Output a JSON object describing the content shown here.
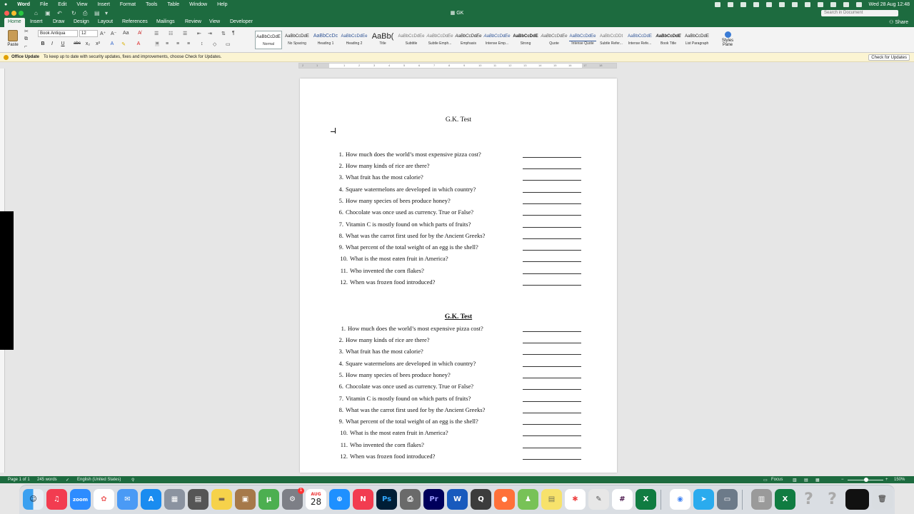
{
  "menubar": {
    "apple": "",
    "items": [
      "Word",
      "File",
      "Edit",
      "View",
      "Insert",
      "Format",
      "Tools",
      "Table",
      "Window",
      "Help"
    ],
    "clock": "Wed 28 Aug  12:48"
  },
  "window": {
    "title": "GK",
    "search_placeholder": "Search in Document",
    "share_label": "Share"
  },
  "tabs": [
    "Home",
    "Insert",
    "Draw",
    "Design",
    "Layout",
    "References",
    "Mailings",
    "Review",
    "View",
    "Developer"
  ],
  "ribbon": {
    "paste_label": "Paste",
    "font_name": "Book Antiqua",
    "font_size": "12",
    "styles": [
      {
        "preview": "AaBbCcDdE",
        "name": "Normal"
      },
      {
        "preview": "AaBbCcDdE",
        "name": "No Spacing"
      },
      {
        "preview": "AaBbCcDc",
        "name": "Heading 1"
      },
      {
        "preview": "AaBbCcDdEe",
        "name": "Heading 2"
      },
      {
        "preview": "AaBb(",
        "name": "Title"
      },
      {
        "preview": "AaBbCcDdEe",
        "name": "Subtitle"
      },
      {
        "preview": "AaBbCcDdEe",
        "name": "Subtle Emph..."
      },
      {
        "preview": "AaBbCcDdEe",
        "name": "Emphasis"
      },
      {
        "preview": "AaBbCcDdEe",
        "name": "Intense Emp..."
      },
      {
        "preview": "AaBbCcDdE",
        "name": "Strong"
      },
      {
        "preview": "AaBbCcDdEe",
        "name": "Quote"
      },
      {
        "preview": "AaBbCcDdEe",
        "name": "Intense Quote"
      },
      {
        "preview": "AaBbCcDDt",
        "name": "Subtle Refer..."
      },
      {
        "preview": "AaBbCcDdE",
        "name": "Intense Refe..."
      },
      {
        "preview": "AaBbCcDdE",
        "name": "Book Title"
      },
      {
        "preview": "AaBbCcDdE",
        "name": "List Paragraph"
      }
    ],
    "styles_pane_label": "Styles Pane"
  },
  "notice": {
    "label": "Office Update",
    "message": "To keep up to date with security updates, fixes and improvements, choose Check for Updates.",
    "button": "Check for Updates"
  },
  "ruler": {
    "ticks": [
      "2",
      "1",
      "1",
      "2",
      "3",
      "4",
      "5",
      "6",
      "7",
      "8",
      "9",
      "10",
      "11",
      "12",
      "13",
      "14",
      "15",
      "16",
      "17",
      "18"
    ]
  },
  "document": {
    "title1": "G.K. Test",
    "title2": "G.K. Test",
    "questions": [
      "How much does the world’s most expensive pizza cost?",
      "How many kinds of rice are there?",
      "What fruit has the most calorie?",
      "Square watermelons are developed in which country?",
      "How many species of bees produce honey?",
      "Chocolate was once used as currency. True or False?",
      "Vitamin C is mostly found on which parts of fruits?",
      "What was the carrot first used for by the Ancient Greeks?",
      "What percent of the total weight of an egg is the shell?",
      "What is the most eaten fruit in America?",
      "Who invented the corn flakes?",
      "When was frozen food introduced?"
    ],
    "numbers": [
      "1.",
      "2.",
      "3.",
      "4.",
      "5.",
      "6.",
      "7.",
      "8.",
      "9.",
      "10.",
      "11.",
      "12."
    ]
  },
  "status": {
    "page": "Page 1 of 1",
    "words": "245 words",
    "language": "English (United States)",
    "focus": "Focus",
    "zoom": "150%"
  },
  "dock": {
    "zoom_label": "zoom",
    "calendar_month": "AUG",
    "calendar_day": "28",
    "ps_label": "Ps",
    "pr_label": "Pr",
    "badge": "1"
  },
  "colors": {
    "accent": "#1d6b3f",
    "notice": "#fbf4d2"
  }
}
